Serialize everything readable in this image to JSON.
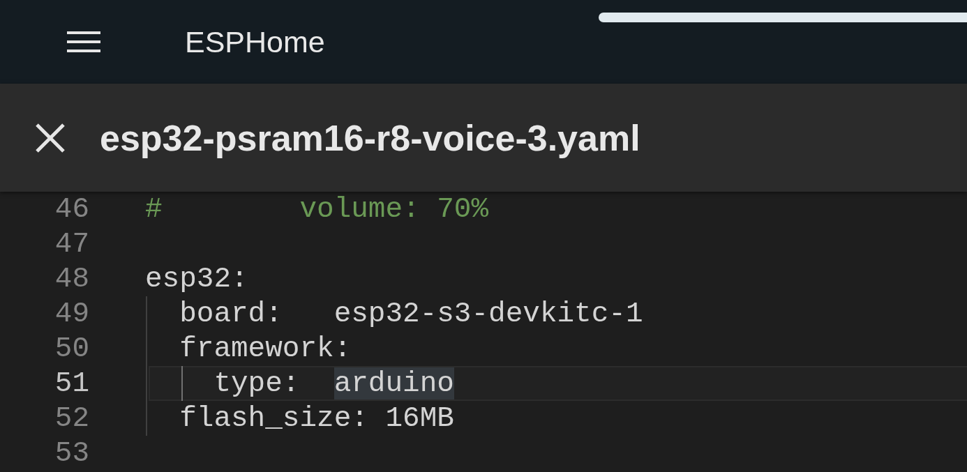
{
  "app_bar": {
    "title": "ESPHome"
  },
  "dialog": {
    "title": "esp32-psram16-r8-voice-3.yaml"
  },
  "editor": {
    "lines": [
      {
        "number": "46",
        "kind": "comment",
        "active": false,
        "segments": [
          {
            "text": "#        volume: 70%",
            "selected": false
          }
        ]
      },
      {
        "number": "47",
        "kind": "blank",
        "active": false
      },
      {
        "number": "48",
        "kind": "code",
        "active": false,
        "segments": [
          {
            "text": "esp32:",
            "selected": false
          }
        ]
      },
      {
        "number": "49",
        "kind": "code",
        "active": false,
        "segments": [
          {
            "text": "  board:   esp32-s3-devkitc-1",
            "selected": false
          }
        ]
      },
      {
        "number": "50",
        "kind": "code",
        "active": false,
        "segments": [
          {
            "text": "  framework:",
            "selected": false
          }
        ]
      },
      {
        "number": "51",
        "kind": "code",
        "active": true,
        "segments": [
          {
            "text": "    type:  ",
            "selected": false
          },
          {
            "text": "arduino",
            "selected": true
          }
        ]
      },
      {
        "number": "52",
        "kind": "code",
        "active": false,
        "segments": [
          {
            "text": "  flash_size: 16MB",
            "selected": false
          }
        ]
      },
      {
        "number": "53",
        "kind": "blank",
        "active": false
      }
    ]
  }
}
